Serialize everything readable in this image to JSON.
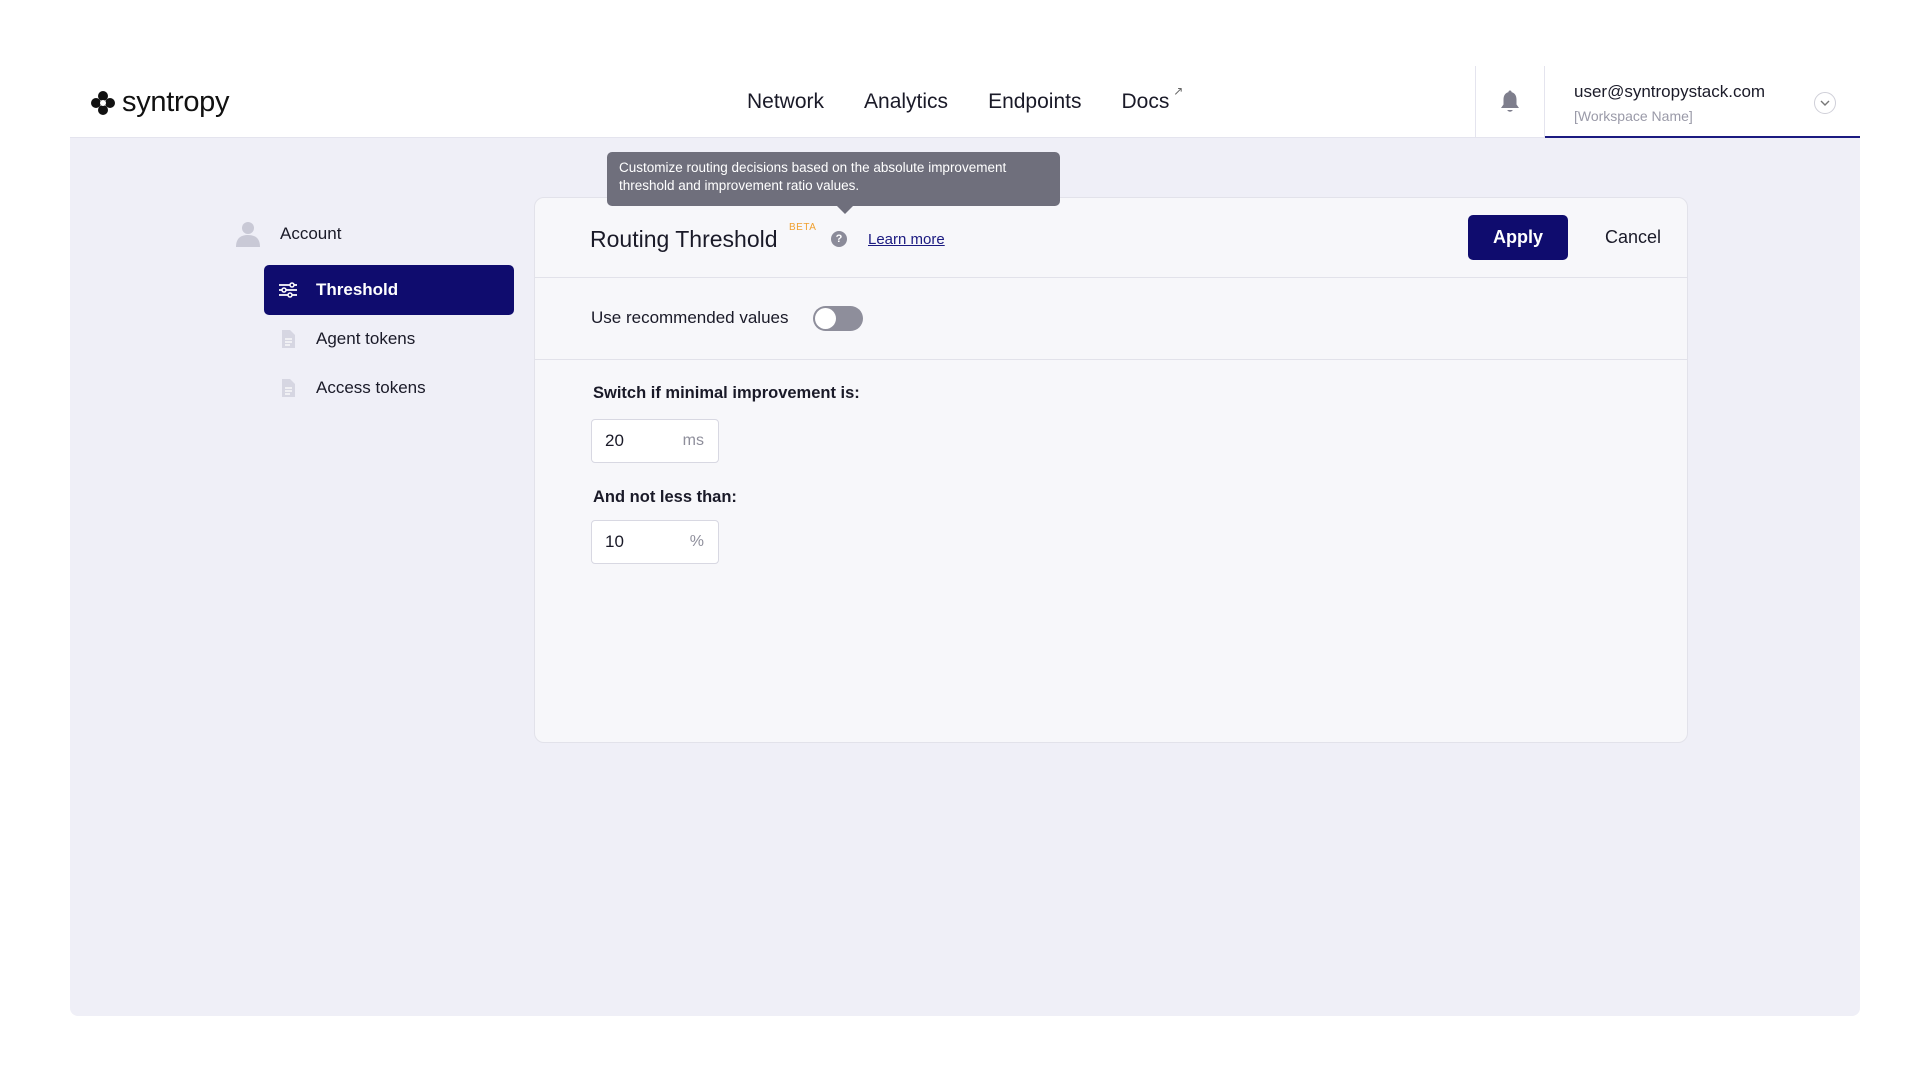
{
  "brand": {
    "name": "syntropy"
  },
  "nav": {
    "items": [
      {
        "label": "Network"
      },
      {
        "label": "Analytics"
      },
      {
        "label": "Endpoints"
      },
      {
        "label": "Docs",
        "external_icon": "↗"
      }
    ]
  },
  "user": {
    "email": "user@syntropystack.com",
    "workspace": "[Workspace Name]"
  },
  "sidebar": {
    "account_label": "Account",
    "items": [
      {
        "label": "Threshold",
        "icon": "sliders-icon",
        "active": true
      },
      {
        "label": "Agent tokens",
        "icon": "document-icon",
        "active": false
      },
      {
        "label": "Access tokens",
        "icon": "document-icon",
        "active": false
      }
    ]
  },
  "panel": {
    "title": "Routing Threshold",
    "badge": "BETA",
    "help_glyph": "?",
    "learn_more": "Learn more",
    "apply_label": "Apply",
    "cancel_label": "Cancel",
    "tooltip": "Customize routing decisions based on the absolute improvement threshold and improvement ratio values.",
    "toggle": {
      "label": "Use recommended values",
      "on": false
    },
    "min_improvement": {
      "label": "Switch if minimal improvement is:",
      "value": "20",
      "unit": "ms"
    },
    "min_ratio": {
      "label": "And not less than:",
      "value": "10",
      "unit": "%"
    }
  },
  "colors": {
    "primary": "#0f0c6e",
    "beta": "#f0a030",
    "background": "#efeff7"
  }
}
